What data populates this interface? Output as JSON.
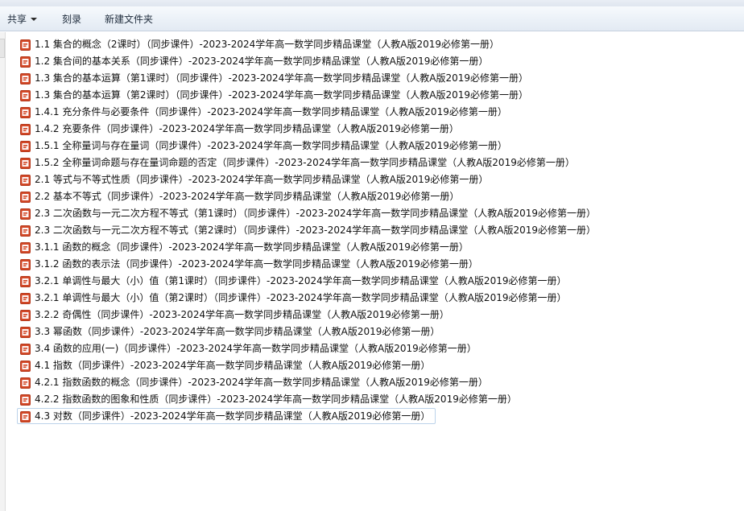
{
  "toolbar": {
    "share_label": "共享",
    "burn_label": "刻录",
    "new_folder_label": "新建文件夹"
  },
  "files": [
    {
      "name": "1.1 集合的概念（2课时）（同步课件）-2023-2024学年高一数学同步精品课堂（人教A版2019必修第一册）"
    },
    {
      "name": "1.2 集合间的基本关系（同步课件）-2023-2024学年高一数学同步精品课堂（人教A版2019必修第一册）"
    },
    {
      "name": "1.3 集合的基本运算（第1课时）（同步课件）-2023-2024学年高一数学同步精品课堂（人教A版2019必修第一册）"
    },
    {
      "name": "1.3 集合的基本运算（第2课时）（同步课件）-2023-2024学年高一数学同步精品课堂（人教A版2019必修第一册）"
    },
    {
      "name": "1.4.1 充分条件与必要条件（同步课件）-2023-2024学年高一数学同步精品课堂（人教A版2019必修第一册）"
    },
    {
      "name": "1.4.2 充要条件（同步课件）-2023-2024学年高一数学同步精品课堂（人教A版2019必修第一册）"
    },
    {
      "name": "1.5.1 全称量词与存在量词（同步课件）-2023-2024学年高一数学同步精品课堂（人教A版2019必修第一册）"
    },
    {
      "name": "1.5.2 全称量词命题与存在量词命题的否定（同步课件）-2023-2024学年高一数学同步精品课堂（人教A版2019必修第一册）"
    },
    {
      "name": "2.1 等式与不等式性质（同步课件）-2023-2024学年高一数学同步精品课堂（人教A版2019必修第一册）"
    },
    {
      "name": "2.2 基本不等式（同步课件）-2023-2024学年高一数学同步精品课堂（人教A版2019必修第一册）"
    },
    {
      "name": "2.3 二次函数与一元二次方程不等式（第1课时）（同步课件）-2023-2024学年高一数学同步精品课堂（人教A版2019必修第一册）"
    },
    {
      "name": "2.3 二次函数与一元二次方程不等式（第2课时）（同步课件）-2023-2024学年高一数学同步精品课堂（人教A版2019必修第一册）"
    },
    {
      "name": "3.1.1 函数的概念（同步课件）-2023-2024学年高一数学同步精品课堂（人教A版2019必修第一册）"
    },
    {
      "name": "3.1.2 函数的表示法（同步课件）-2023-2024学年高一数学同步精品课堂（人教A版2019必修第一册）"
    },
    {
      "name": "3.2.1 单调性与最大（小）值（第1课时）（同步课件）-2023-2024学年高一数学同步精品课堂（人教A版2019必修第一册）"
    },
    {
      "name": "3.2.1 单调性与最大（小）值（第2课时）（同步课件）-2023-2024学年高一数学同步精品课堂（人教A版2019必修第一册）"
    },
    {
      "name": "3.2.2 奇偶性（同步课件）-2023-2024学年高一数学同步精品课堂（人教A版2019必修第一册）"
    },
    {
      "name": "3.3 幂函数（同步课件）-2023-2024学年高一数学同步精品课堂（人教A版2019必修第一册）"
    },
    {
      "name": "3.4 函数的应用(一)（同步课件）-2023-2024学年高一数学同步精品课堂（人教A版2019必修第一册）"
    },
    {
      "name": "4.1 指数（同步课件）-2023-2024学年高一数学同步精品课堂（人教A版2019必修第一册）"
    },
    {
      "name": "4.2.1 指数函数的概念（同步课件）-2023-2024学年高一数学同步精品课堂（人教A版2019必修第一册）"
    },
    {
      "name": "4.2.2 指数函数的图象和性质（同步课件）-2023-2024学年高一数学同步精品课堂（人教A版2019必修第一册）"
    },
    {
      "name": "4.3 对数（同步课件）-2023-2024学年高一数学同步精品课堂（人教A版2019必修第一册）",
      "selected": true
    }
  ],
  "colors": {
    "ppt_icon": "#d24726",
    "ppt_icon_dark": "#b5391c",
    "selection_border": "#bcd3ea"
  },
  "icons": {
    "file": "powerpoint-file-icon",
    "share_dropdown": "chevron-down-icon"
  }
}
